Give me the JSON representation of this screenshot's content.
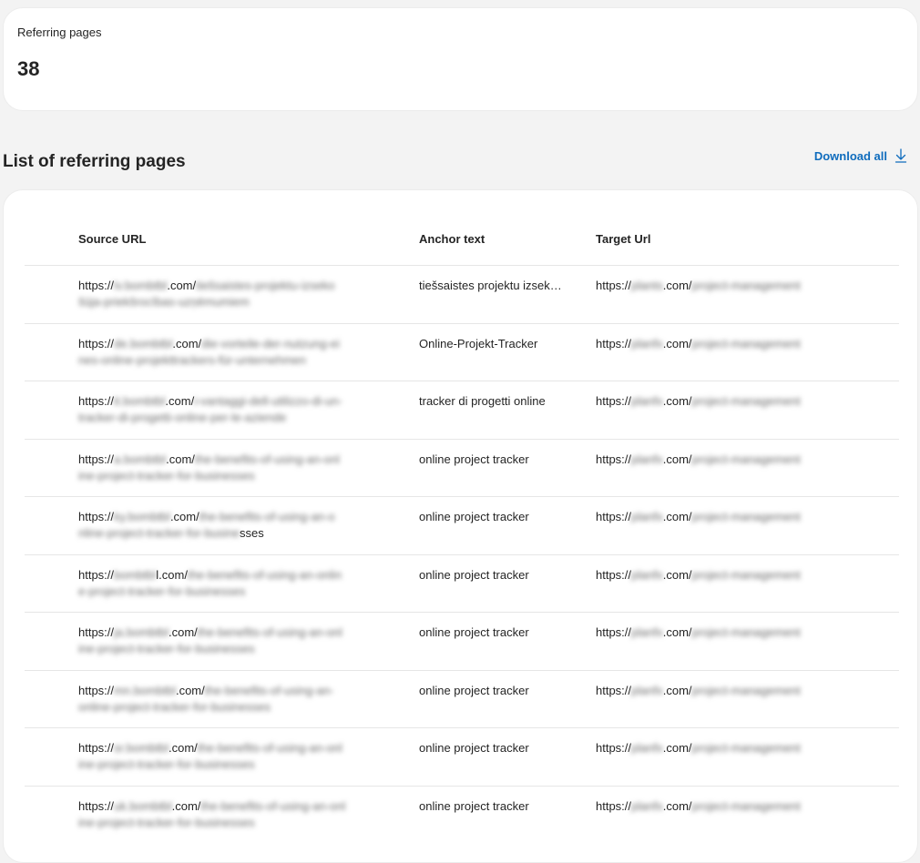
{
  "stat": {
    "label": "Referring pages",
    "value": "38"
  },
  "section": {
    "title": "List of referring pages",
    "download_label": "Download all"
  },
  "table": {
    "headers": {
      "source": "Source URL",
      "anchor": "Anchor text",
      "target": "Target Url"
    },
    "rows": [
      {
        "src_a": "https://",
        "src_b": "lv.bombtbl",
        "src_c": ".com/",
        "src_d": "tiešsaistes-projektu-izseko",
        "src_e": "šūja-priekšrocības-uzņēmumiem",
        "src_f": "",
        "anchor": "tiešsaistes projektu izsekotājs",
        "tgt_a": "https://",
        "tgt_b": "plants",
        "tgt_c": ".com/",
        "tgt_d": "project-management"
      },
      {
        "src_a": "https://",
        "src_b": "de.bombtbl",
        "src_c": ".com/",
        "src_d": "die-vorteile-der-nutzung-ei",
        "src_e": "nes-online-projekttrackers-für-unternehmen",
        "src_f": "",
        "anchor": "Online-Projekt-Tracker",
        "tgt_a": "https://",
        "tgt_b": "planfx",
        "tgt_c": ".com/",
        "tgt_d": "project-management"
      },
      {
        "src_a": "https://",
        "src_b": "it.bombtbl",
        "src_c": ".com/",
        "src_d": "i-vantaggi-dell-utilizzo-di-un-",
        "src_e": "tracker-di-progetti-online-per-le-aziende",
        "src_f": "",
        "anchor": "tracker di progetti online",
        "tgt_a": "https://",
        "tgt_b": "planfx",
        "tgt_c": ".com/",
        "tgt_d": "project-management"
      },
      {
        "src_a": "https://",
        "src_b": "a.bombtbl",
        "src_c": ".com/",
        "src_d": "the-benefits-of-using-an-onl",
        "src_e": "ine-project-tracker-for-businesses",
        "src_f": "",
        "anchor": "online project tracker",
        "tgt_a": "https://",
        "tgt_b": "planfx",
        "tgt_c": ".com/",
        "tgt_d": "project-management"
      },
      {
        "src_a": "https://",
        "src_b": "ky.bombtbl",
        "src_c": ".com/",
        "src_d": "the-benefits-of-using-an-o",
        "src_e": "nline-project-tracker-for-busine",
        "src_f": "sses",
        "anchor": "online project tracker",
        "tgt_a": "https://",
        "tgt_b": "planfx",
        "tgt_c": ".com/",
        "tgt_d": "project-management"
      },
      {
        "src_a": "https://",
        "src_b": "bombtbl",
        "src_c": "l.com/",
        "src_d": "the-benefits-of-using-an-onlin",
        "src_e": "e-project-tracker-for-businesses",
        "src_f": "",
        "anchor": "online project tracker",
        "tgt_a": "https://",
        "tgt_b": "planfx",
        "tgt_c": ".com/",
        "tgt_d": "project-management"
      },
      {
        "src_a": "https://",
        "src_b": "ja.bombtbl",
        "src_c": ".com/",
        "src_d": "the-benefits-of-using-an-onl",
        "src_e": "ine-project-tracker-for-businesses",
        "src_f": "",
        "anchor": "online project tracker",
        "tgt_a": "https://",
        "tgt_b": "planfx",
        "tgt_c": ".com/",
        "tgt_d": "project-management"
      },
      {
        "src_a": "https://",
        "src_b": "mn.bombtbl",
        "src_c": ".com/",
        "src_d": "the-benefits-of-using-an-",
        "src_e": "online-project-tracker-for-businesses",
        "src_f": "",
        "anchor": "online project tracker",
        "tgt_a": "https://",
        "tgt_b": "planfx",
        "tgt_c": ".com/",
        "tgt_d": "project-management"
      },
      {
        "src_a": "https://",
        "src_b": "sr.bombtbl",
        "src_c": ".com/",
        "src_d": "the-benefits-of-using-an-onl",
        "src_e": "ine-project-tracker-for-businesses",
        "src_f": "",
        "anchor": "online project tracker",
        "tgt_a": "https://",
        "tgt_b": "planfx",
        "tgt_c": ".com/",
        "tgt_d": "project-management"
      },
      {
        "src_a": "https://",
        "src_b": "uk.bombtbl",
        "src_c": ".com/",
        "src_d": "the-benefits-of-using-an-onl",
        "src_e": "ine-project-tracker-for-businesses",
        "src_f": "",
        "anchor": "online project tracker",
        "tgt_a": "https://",
        "tgt_b": "planfx",
        "tgt_c": ".com/",
        "tgt_d": "project-management"
      }
    ]
  },
  "colors": {
    "accent": "#0f6cbd",
    "background": "#f3f3f3",
    "card": "#ffffff",
    "divider": "#e6e6e6"
  }
}
